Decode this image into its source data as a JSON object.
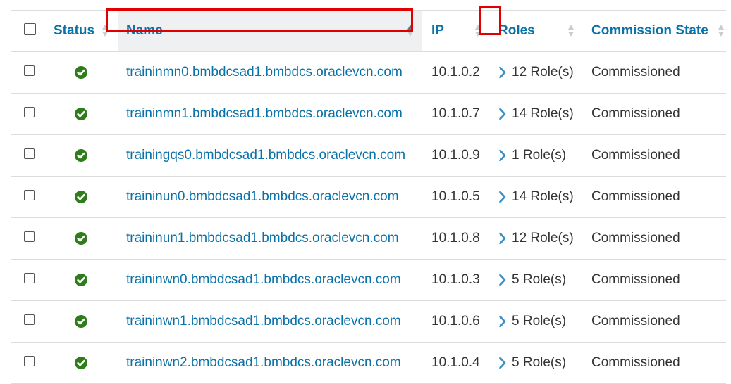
{
  "columns": {
    "status": "Status",
    "name": "Name",
    "ip": "IP",
    "roles": "Roles",
    "commission_state": "Commission State"
  },
  "sort": {
    "column": "name",
    "direction": "ascending"
  },
  "colors": {
    "link": "#0a72a8",
    "status_ok": "#2e7d1a",
    "highlight": "#e00000"
  },
  "rows": [
    {
      "name": "traininmn0.bmbdcsad1.bmbdcs.oraclevcn.com",
      "ip": "10.1.0.2",
      "roles": "12 Role(s)",
      "state": "Commissioned",
      "status_icon": "check-circle-icon"
    },
    {
      "name": "traininmn1.bmbdcsad1.bmbdcs.oraclevcn.com",
      "ip": "10.1.0.7",
      "roles": "14 Role(s)",
      "state": "Commissioned",
      "status_icon": "check-circle-icon"
    },
    {
      "name": "trainingqs0.bmbdcsad1.bmbdcs.oraclevcn.com",
      "ip": "10.1.0.9",
      "roles": "1 Role(s)",
      "state": "Commissioned",
      "status_icon": "check-circle-icon"
    },
    {
      "name": "traininun0.bmbdcsad1.bmbdcs.oraclevcn.com",
      "ip": "10.1.0.5",
      "roles": "14 Role(s)",
      "state": "Commissioned",
      "status_icon": "check-circle-icon"
    },
    {
      "name": "traininun1.bmbdcsad1.bmbdcs.oraclevcn.com",
      "ip": "10.1.0.8",
      "roles": "12 Role(s)",
      "state": "Commissioned",
      "status_icon": "check-circle-icon"
    },
    {
      "name": "traininwn0.bmbdcsad1.bmbdcs.oraclevcn.com",
      "ip": "10.1.0.3",
      "roles": "5 Role(s)",
      "state": "Commissioned",
      "status_icon": "check-circle-icon"
    },
    {
      "name": "traininwn1.bmbdcsad1.bmbdcs.oraclevcn.com",
      "ip": "10.1.0.6",
      "roles": "5 Role(s)",
      "state": "Commissioned",
      "status_icon": "check-circle-icon"
    },
    {
      "name": "traininwn2.bmbdcsad1.bmbdcs.oraclevcn.com",
      "ip": "10.1.0.4",
      "roles": "5 Role(s)",
      "state": "Commissioned",
      "status_icon": "check-circle-icon"
    }
  ]
}
